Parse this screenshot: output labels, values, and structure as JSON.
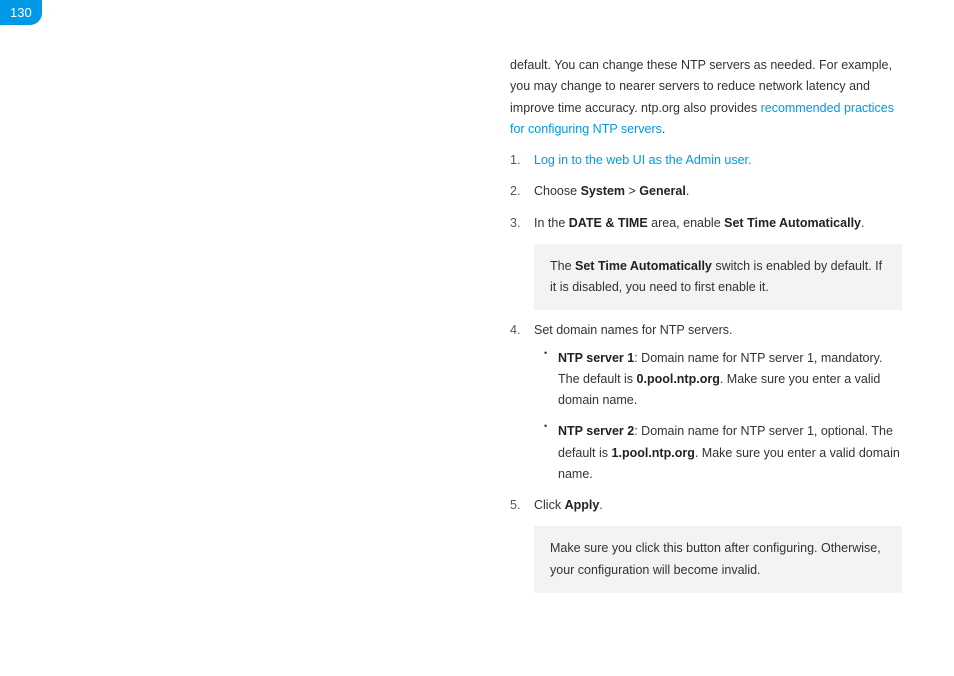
{
  "page_number": "130",
  "intro": {
    "text_before_link": "default. You can change these NTP servers as needed. For example, you may change to nearer servers to reduce network latency and improve time accuracy. ntp.org also provides ",
    "link_text": "recommended practices for configuring NTP servers",
    "text_after_link": "."
  },
  "steps": {
    "s1_link": "Log in to the web UI as the Admin user.",
    "s2_a": "Choose ",
    "s2_b": "System",
    "s2_c": " > ",
    "s2_d": "General",
    "s2_e": ".",
    "s3_a": "In the ",
    "s3_b": "DATE & TIME",
    "s3_c": " area, enable ",
    "s3_d": "Set Time Automatically",
    "s3_e": ".",
    "note1_a": "The ",
    "note1_b": "Set Time Automatically",
    "note1_c": " switch is enabled by default. If it is disabled, you need to first enable it.",
    "s4": "Set domain names for NTP servers.",
    "s4_sub1_a": "NTP server 1",
    "s4_sub1_b": ": Domain name for NTP server 1, mandatory. The default is ",
    "s4_sub1_c": "0.pool.ntp.org",
    "s4_sub1_d": ". Make sure you enter a valid domain name.",
    "s4_sub2_a": "NTP server 2",
    "s4_sub2_b": ": Domain name for NTP server 1, optional. The default is ",
    "s4_sub2_c": "1.pool.ntp.org",
    "s4_sub2_d": ". Make sure you enter a valid domain name.",
    "s5_a": "Click ",
    "s5_b": "Apply",
    "s5_c": ".",
    "note2": "Make sure you click this button after configuring. Otherwise, your configuration will become invalid."
  }
}
